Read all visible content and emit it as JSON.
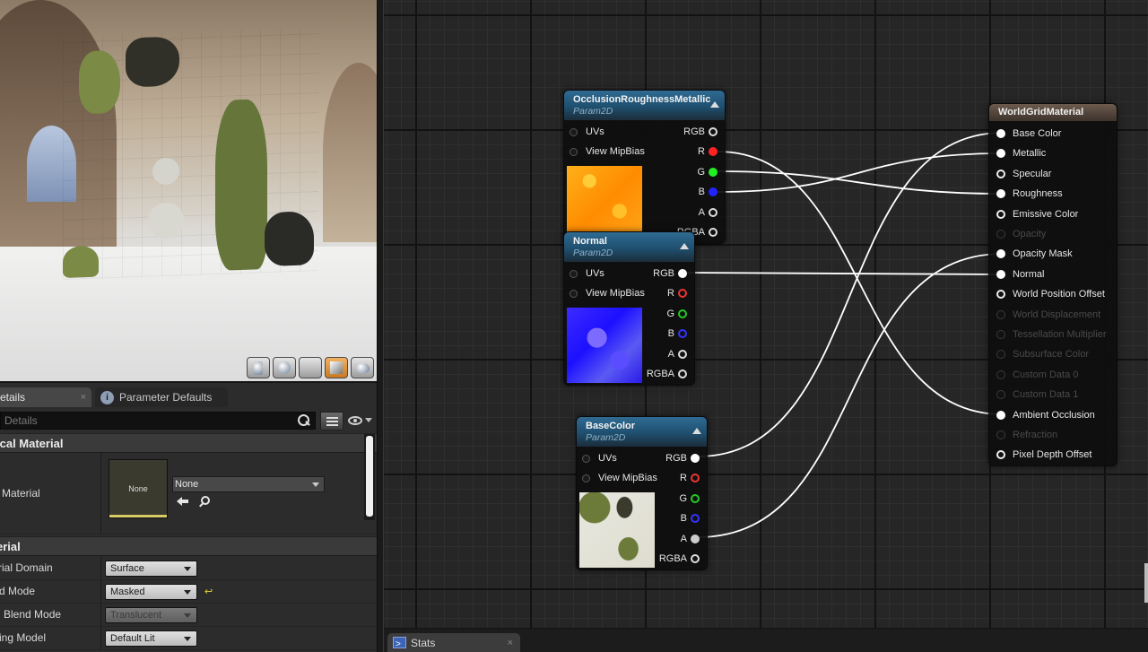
{
  "details_panel": {
    "tabs": [
      {
        "label": "etails",
        "active": true
      },
      {
        "label": "Parameter Defaults",
        "active": false
      }
    ],
    "close_glyph": "×",
    "search_placeholder": "Details",
    "categories": {
      "physical_material": {
        "header": "ical Material",
        "property_label": "Material",
        "thumbnail_label": "None",
        "combo_value": "None"
      },
      "material": {
        "header": "erial",
        "rows": [
          {
            "label": "rial Domain",
            "value": "Surface",
            "enabled": true,
            "reset": false
          },
          {
            "label": "d Mode",
            "value": "Masked",
            "enabled": true,
            "reset": true
          },
          {
            "label": "Blend Mode",
            "value": "Translucent",
            "enabled": false,
            "reset": false
          },
          {
            "label": "ing Model",
            "value": "Default Lit",
            "enabled": true,
            "reset": false
          }
        ]
      }
    }
  },
  "viewport": {
    "preview_buttons": [
      "cylinder-icon",
      "sphere-icon",
      "plane-icon",
      "cube-icon",
      "teapot-icon"
    ],
    "active_preview": "cube-icon"
  },
  "graph": {
    "nodes": {
      "orm": {
        "title": "OcclusionRoughnessMetallic",
        "subtitle": "Param2D",
        "inputs": [
          "UVs",
          "View MipBias"
        ],
        "outputs": [
          "RGB",
          "R",
          "G",
          "B",
          "A",
          "RGBA"
        ]
      },
      "normal": {
        "title": "Normal",
        "subtitle": "Param2D",
        "inputs": [
          "UVs",
          "View MipBias"
        ],
        "outputs": [
          "RGB",
          "R",
          "G",
          "B",
          "A",
          "RGBA"
        ]
      },
      "basecolor": {
        "title": "BaseColor",
        "subtitle": "Param2D",
        "inputs": [
          "UVs",
          "View MipBias"
        ],
        "outputs": [
          "RGB",
          "R",
          "G",
          "B",
          "A",
          "RGBA"
        ]
      },
      "result": {
        "title": "WorldGridMaterial",
        "inputs": [
          {
            "label": "Base Color",
            "enabled": true,
            "connected": true
          },
          {
            "label": "Metallic",
            "enabled": true,
            "connected": true
          },
          {
            "label": "Specular",
            "enabled": true,
            "connected": false
          },
          {
            "label": "Roughness",
            "enabled": true,
            "connected": true
          },
          {
            "label": "Emissive Color",
            "enabled": true,
            "connected": false
          },
          {
            "label": "Opacity",
            "enabled": false,
            "connected": false
          },
          {
            "label": "Opacity Mask",
            "enabled": true,
            "connected": true
          },
          {
            "label": "Normal",
            "enabled": true,
            "connected": true
          },
          {
            "label": "World Position Offset",
            "enabled": true,
            "connected": false
          },
          {
            "label": "World Displacement",
            "enabled": false,
            "connected": false
          },
          {
            "label": "Tessellation Multiplier",
            "enabled": false,
            "connected": false
          },
          {
            "label": "Subsurface Color",
            "enabled": false,
            "connected": false
          },
          {
            "label": "Custom Data 0",
            "enabled": false,
            "connected": false
          },
          {
            "label": "Custom Data 1",
            "enabled": false,
            "connected": false
          },
          {
            "label": "Ambient Occlusion",
            "enabled": true,
            "connected": true
          },
          {
            "label": "Refraction",
            "enabled": false,
            "connected": false
          },
          {
            "label": "Pixel Depth Offset",
            "enabled": true,
            "connected": false
          }
        ]
      }
    }
  },
  "bottom_tab": {
    "label": "Stats",
    "close_glyph": "×"
  },
  "colors": {
    "node_header_blue": "#2f6b93",
    "result_header_brown": "#6c5a4d",
    "pin_red": "#ff2222",
    "pin_green": "#22ee22",
    "pin_blue": "#2222ff",
    "wire": "#ffffff",
    "active_preview_button": "#e09a42"
  }
}
